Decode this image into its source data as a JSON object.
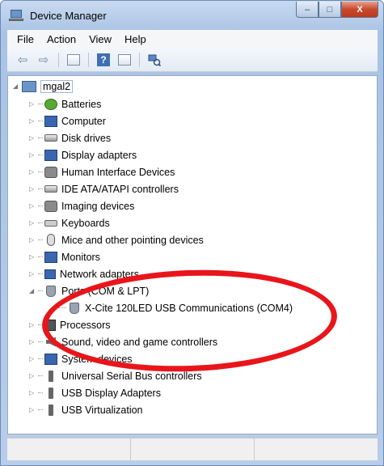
{
  "window": {
    "title": "Device Manager",
    "buttons": {
      "minimize": "–",
      "maximize": "□",
      "close": "X"
    }
  },
  "menu": {
    "items": [
      {
        "label": "File"
      },
      {
        "label": "Action"
      },
      {
        "label": "View"
      },
      {
        "label": "Help"
      }
    ]
  },
  "toolbar": {
    "back": "⇦",
    "forward": "⇨",
    "help": "?",
    "icons": [
      "back-arrow-icon",
      "forward-arrow-icon",
      "properties-icon",
      "help-icon",
      "view-icon",
      "scan-hardware-icon"
    ]
  },
  "tree": {
    "root": {
      "label": "mgal2",
      "icon": "computer-icon"
    },
    "items": [
      {
        "label": "Batteries",
        "icon": "battery-icon"
      },
      {
        "label": "Computer",
        "icon": "computer-icon"
      },
      {
        "label": "Disk drives",
        "icon": "disk-drive-icon"
      },
      {
        "label": "Display adapters",
        "icon": "display-adapter-icon"
      },
      {
        "label": "Human Interface Devices",
        "icon": "hid-icon"
      },
      {
        "label": "IDE ATA/ATAPI controllers",
        "icon": "ide-controller-icon"
      },
      {
        "label": "Imaging devices",
        "icon": "imaging-device-icon"
      },
      {
        "label": "Keyboards",
        "icon": "keyboard-icon"
      },
      {
        "label": "Mice and other pointing devices",
        "icon": "mouse-icon"
      },
      {
        "label": "Monitors",
        "icon": "monitor-icon"
      },
      {
        "label": "Network adapters",
        "icon": "network-adapter-icon"
      },
      {
        "label": "Ports (COM & LPT)",
        "icon": "port-icon",
        "expanded": true
      },
      {
        "label": "X-Cite 120LED USB Communications (COM4)",
        "icon": "port-device-icon",
        "child": true
      },
      {
        "label": "Processors",
        "icon": "processor-icon"
      },
      {
        "label": "Sound, video and game controllers",
        "icon": "sound-icon"
      },
      {
        "label": "System devices",
        "icon": "system-device-icon"
      },
      {
        "label": "Universal Serial Bus controllers",
        "icon": "usb-icon"
      },
      {
        "label": "USB Display Adapters",
        "icon": "usb-icon"
      },
      {
        "label": "USB Virtualization",
        "icon": "usb-icon"
      }
    ]
  },
  "colors": {
    "highlight_ellipse": "#e8151b",
    "title_bar": "#b7cde9"
  }
}
